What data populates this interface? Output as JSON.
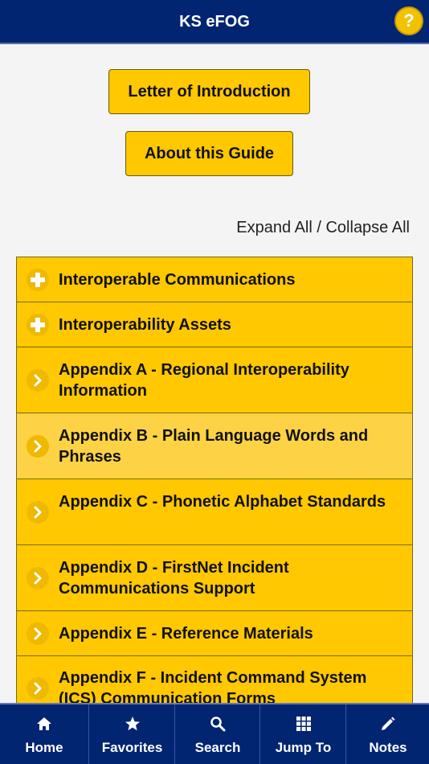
{
  "header": {
    "title": "KS eFOG",
    "help_label": "?"
  },
  "buttons": {
    "letter": "Letter of Introduction",
    "about": "About this Guide"
  },
  "expand": {
    "expand_label": "Expand All",
    "separator": " / ",
    "collapse_label": "Collapse All"
  },
  "sections": [
    {
      "label": "Interoperable Communications",
      "icon": "plus-icon"
    },
    {
      "label": "Interoperability Assets",
      "icon": "plus-icon"
    },
    {
      "label": "Appendix A - Regional Interoperability Information",
      "icon": "chevron-right-icon"
    },
    {
      "label": "Appendix B - Plain Language Words and Phrases",
      "icon": "chevron-right-icon"
    },
    {
      "label": "Appendix C - Phonetic Alphabet Standards",
      "icon": "chevron-right-icon"
    },
    {
      "label": "Appendix D - FirstNet Incident Communications Support",
      "icon": "chevron-right-icon"
    },
    {
      "label": "Appendix E - Reference Materials",
      "icon": "chevron-right-icon"
    },
    {
      "label": "Appendix F - Incident Command System (ICS) Communication Forms",
      "icon": "chevron-right-icon"
    }
  ],
  "tabs": [
    {
      "label": "Home",
      "icon": "home-icon"
    },
    {
      "label": "Favorites",
      "icon": "star-icon"
    },
    {
      "label": "Search",
      "icon": "search-icon"
    },
    {
      "label": "Jump To",
      "icon": "grid-icon"
    },
    {
      "label": "Notes",
      "icon": "pencil-icon"
    }
  ],
  "colors": {
    "navy": "#022571",
    "gold": "#ffc800",
    "highlight": "#fdd244"
  }
}
